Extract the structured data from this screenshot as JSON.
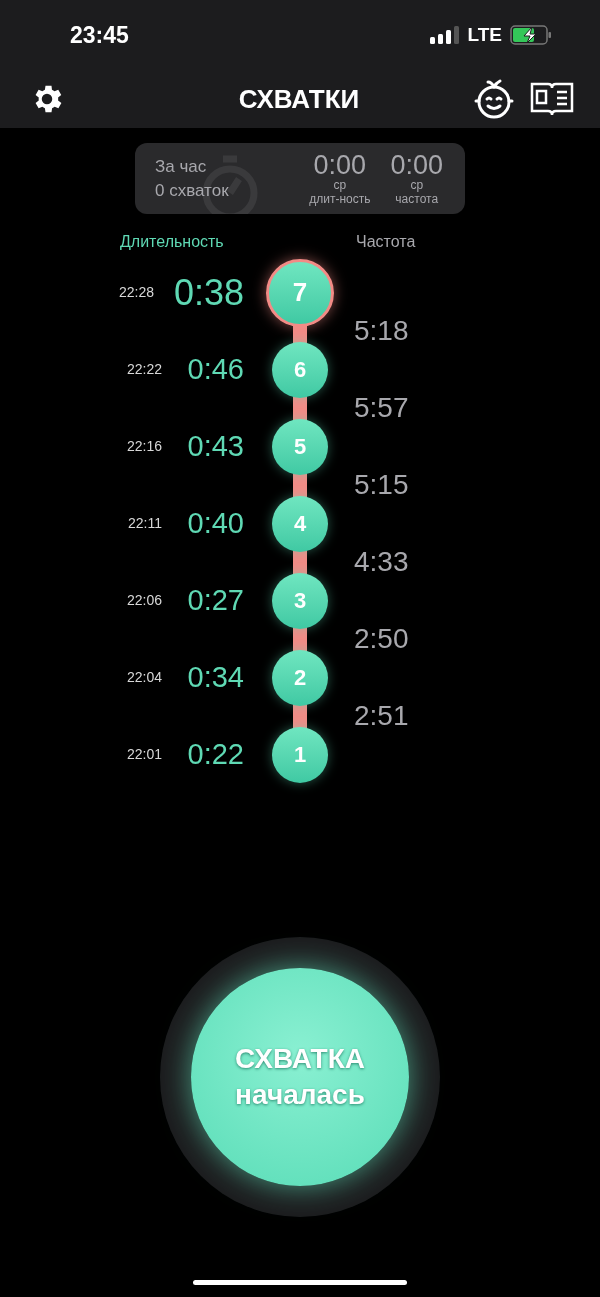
{
  "status_bar": {
    "time": "23:45",
    "network": "LTE"
  },
  "nav": {
    "title": "СХВАТКИ"
  },
  "summary": {
    "period": "За час",
    "count": "0 схваток",
    "stats": [
      {
        "value": "0:00",
        "abbr": "ср",
        "label": "длит-ность"
      },
      {
        "value": "0:00",
        "abbr": "ср",
        "label": "частота"
      }
    ]
  },
  "headers": {
    "duration": "Длительность",
    "frequency": "Частота"
  },
  "contractions": [
    {
      "number": "7",
      "time": "22:28",
      "duration": "0:38",
      "selected": true
    },
    {
      "number": "6",
      "time": "22:22",
      "duration": "0:46",
      "selected": false
    },
    {
      "number": "5",
      "time": "22:16",
      "duration": "0:43",
      "selected": false
    },
    {
      "number": "4",
      "time": "22:11",
      "duration": "0:40",
      "selected": false
    },
    {
      "number": "3",
      "time": "22:06",
      "duration": "0:27",
      "selected": false
    },
    {
      "number": "2",
      "time": "22:04",
      "duration": "0:34",
      "selected": false
    },
    {
      "number": "1",
      "time": "22:01",
      "duration": "0:22",
      "selected": false
    }
  ],
  "intervals": [
    "5:18",
    "5:57",
    "5:15",
    "4:33",
    "2:50",
    "2:51"
  ],
  "start_button": {
    "line1": "СХВАТКА",
    "line2": "началась"
  }
}
